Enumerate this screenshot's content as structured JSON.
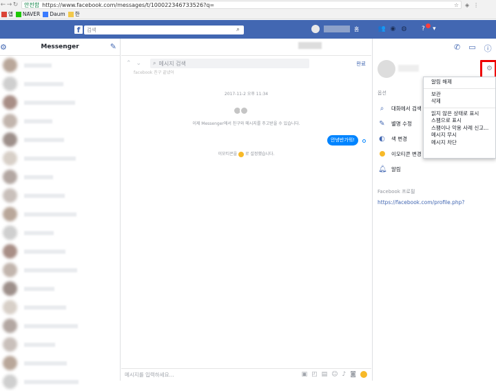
{
  "browser": {
    "secure_label": "안전함",
    "url": "https://www.facebook.com/messages/t/100022346733526?q=",
    "bookmarks": [
      "앱",
      "NAVER",
      "Daum",
      "한"
    ]
  },
  "fb": {
    "search_placeholder": "검색",
    "nav_home_label": "홈"
  },
  "left": {
    "title": "Messenger",
    "conversation_count": 18
  },
  "chat": {
    "search_placeholder": "메시지 검색",
    "done_label": "완료",
    "faded_text": "facebook 친구 끝냈어",
    "timestamp": "2017-11-2 오후 11:34",
    "info_text": "이제 Messenger에서 친구와 메시지를 주고받을 수 있습니다.",
    "bubble_text": "안녕반가워!",
    "emoji_text_prefix": "이모티콘을",
    "emoji_text_suffix": "로 설정했습니다.",
    "composer_placeholder": "메시지를 입력하세요..."
  },
  "right_panel": {
    "options_label": "옵션",
    "items": [
      {
        "icon": "search-icon",
        "label": "대화에서 검색"
      },
      {
        "icon": "pencil-icon",
        "label": "별명 수정"
      },
      {
        "icon": "palette-icon",
        "label": "색 변경"
      },
      {
        "icon": "emoji-icon",
        "label": "이모티콘 변경"
      },
      {
        "icon": "bell-icon",
        "label": "알림"
      }
    ],
    "profile_header": "Facebook 프로필",
    "profile_link": "https://facebook.com/profile.php?"
  },
  "dropdown": {
    "group1": [
      "알림 해제"
    ],
    "group2": [
      "보관",
      "삭제"
    ],
    "group3": [
      "읽지 않은 상태로 표시",
      "스팸으로 표시",
      "스팸이나 악용 사례 신고...",
      "메시지 무시",
      "메시지 차단"
    ]
  },
  "colors": {
    "facebook_blue": "#4267b2",
    "messenger_blue": "#0084ff",
    "highlight_red": "#ee0000"
  }
}
